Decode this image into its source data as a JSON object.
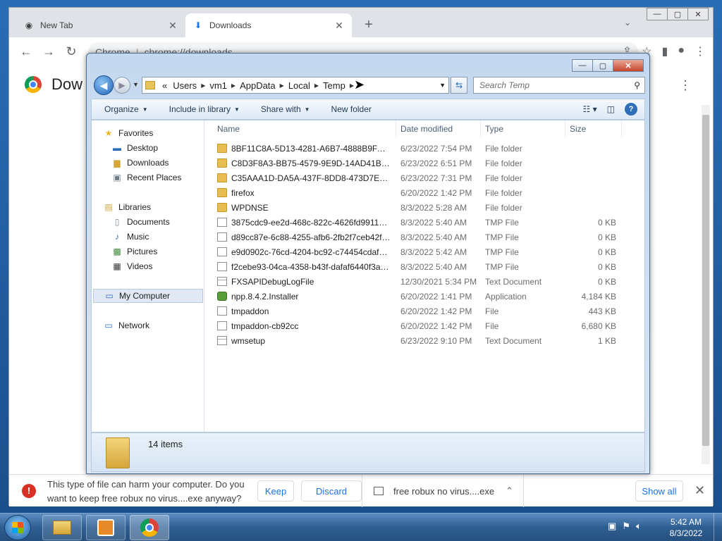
{
  "chrome": {
    "tabs": [
      {
        "label": "New Tab",
        "close": "✕",
        "active": false
      },
      {
        "label": "Downloads",
        "close": "✕",
        "active": true
      }
    ],
    "new_tab": "+",
    "tab_list": "⌄",
    "window_controls": {
      "minimize": "—",
      "maximize": "▢",
      "close": "✕"
    },
    "omnibox": {
      "site": "Chrome",
      "url": "chrome://downloads"
    },
    "page_title": "Dow",
    "download_bar": {
      "warning_text": "This type of file can harm your computer. Do you want to keep free robux no virus....exe anyway?",
      "keep_label": "Keep",
      "discard_label": "Discard",
      "file_name": "free robux no virus....exe",
      "show_all_label": "Show all",
      "close": "✕"
    }
  },
  "explorer": {
    "window_controls": {
      "minimize": "—",
      "maximize": "▢",
      "close": "✕"
    },
    "breadcrumb": [
      "«",
      "Users",
      "vm1",
      "AppData",
      "Local",
      "Temp"
    ],
    "search_placeholder": "Search Temp",
    "commands": {
      "organize": "Organize",
      "include_in_library": "Include in library",
      "share_with": "Share with",
      "new_folder": "New folder"
    },
    "nav": {
      "favorites": "Favorites",
      "desktop": "Desktop",
      "downloads": "Downloads",
      "recent_places": "Recent Places",
      "libraries": "Libraries",
      "documents": "Documents",
      "music": "Music",
      "pictures": "Pictures",
      "videos": "Videos",
      "my_computer": "My Computer",
      "network": "Network"
    },
    "columns": {
      "name": "Name",
      "date_modified": "Date modified",
      "type": "Type",
      "size": "Size"
    },
    "files": [
      {
        "name": "8BF11C8A-5D13-4281-A6B7-4888B9FAB88...",
        "date": "6/23/2022 7:54 PM",
        "type": "File folder",
        "size": "",
        "icon": "folder"
      },
      {
        "name": "C8D3F8A3-BB75-4579-9E9D-14AD41BD3...",
        "date": "6/23/2022 6:51 PM",
        "type": "File folder",
        "size": "",
        "icon": "folder"
      },
      {
        "name": "C35AAA1D-DA5A-437F-8DD8-473D7E327...",
        "date": "6/23/2022 7:31 PM",
        "type": "File folder",
        "size": "",
        "icon": "folder"
      },
      {
        "name": "firefox",
        "date": "6/20/2022 1:42 PM",
        "type": "File folder",
        "size": "",
        "icon": "folder"
      },
      {
        "name": "WPDNSE",
        "date": "8/3/2022 5:28 AM",
        "type": "File folder",
        "size": "",
        "icon": "folder"
      },
      {
        "name": "3875cdc9-ee2d-468c-822c-4626fd99116f....",
        "date": "8/3/2022 5:40 AM",
        "type": "TMP File",
        "size": "0 KB",
        "icon": "doc"
      },
      {
        "name": "d89cc87e-6c88-4255-afb6-2fb2f7ceb42f.t...",
        "date": "8/3/2022 5:40 AM",
        "type": "TMP File",
        "size": "0 KB",
        "icon": "doc"
      },
      {
        "name": "e9d0902c-76cd-4204-bc92-c74454cdaf4f....",
        "date": "8/3/2022 5:42 AM",
        "type": "TMP File",
        "size": "0 KB",
        "icon": "doc"
      },
      {
        "name": "f2cebe93-04ca-4358-b43f-dafaf6440f3a.t...",
        "date": "8/3/2022 5:40 AM",
        "type": "TMP File",
        "size": "0 KB",
        "icon": "doc"
      },
      {
        "name": "FXSAPIDebugLogFile",
        "date": "12/30/2021 5:34 PM",
        "type": "Text Document",
        "size": "0 KB",
        "icon": "txt"
      },
      {
        "name": "npp.8.4.2.Installer",
        "date": "6/20/2022 1:41 PM",
        "type": "Application",
        "size": "4,184 KB",
        "icon": "app"
      },
      {
        "name": "tmpaddon",
        "date": "6/20/2022 1:42 PM",
        "type": "File",
        "size": "443 KB",
        "icon": "doc"
      },
      {
        "name": "tmpaddon-cb92cc",
        "date": "6/20/2022 1:42 PM",
        "type": "File",
        "size": "6,680 KB",
        "icon": "doc"
      },
      {
        "name": "wmsetup",
        "date": "6/23/2022 9:10 PM",
        "type": "Text Document",
        "size": "1 KB",
        "icon": "txt"
      }
    ],
    "status": "14 items"
  },
  "taskbar": {
    "clock_time": "5:42 AM",
    "clock_date": "8/3/2022"
  }
}
